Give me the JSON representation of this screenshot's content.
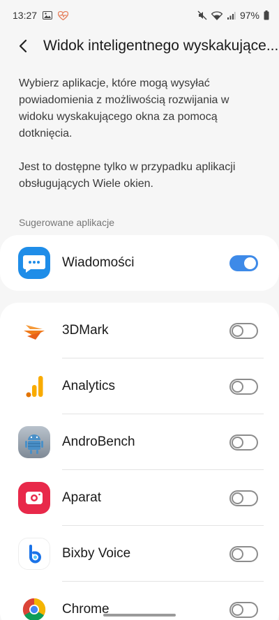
{
  "status_bar": {
    "time": "13:27",
    "battery": "97%"
  },
  "header": {
    "title": "Widok inteligentnego wyskakujące..."
  },
  "description": {
    "paragraph1": "Wybierz aplikacje, które mogą wysyłać powiadomienia z możliwością rozwijania w widoku wyskakującego okna za pomocą dotknięcia.",
    "paragraph2": "Jest to dostępne tylko w przypadku aplikacji obsługujących Wiele okien."
  },
  "suggested": {
    "section_label": "Sugerowane aplikacje",
    "app": {
      "label": "Wiadomości",
      "icon": "messages-icon",
      "enabled": true
    }
  },
  "apps": [
    {
      "label": "3DMark",
      "icon": "3dmark-icon",
      "enabled": false
    },
    {
      "label": "Analytics",
      "icon": "analytics-icon",
      "enabled": false
    },
    {
      "label": "AndroBench",
      "icon": "androbench-icon",
      "enabled": false
    },
    {
      "label": "Aparat",
      "icon": "camera-icon",
      "enabled": false
    },
    {
      "label": "Bixby Voice",
      "icon": "bixby-icon",
      "enabled": false
    },
    {
      "label": "Chrome",
      "icon": "chrome-icon",
      "enabled": false
    }
  ],
  "colors": {
    "accent": "#3e8ae8",
    "background": "#f6f6f6"
  }
}
